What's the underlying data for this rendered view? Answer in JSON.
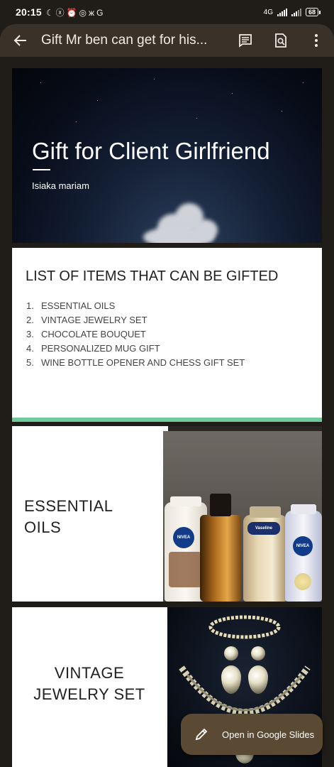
{
  "status_bar": {
    "time": "20:15",
    "notification_icons": [
      "moon-icon",
      "mute-icon",
      "alarm-icon",
      "instagram-icon",
      "butterfly-icon",
      "google-icon"
    ],
    "network": "4G",
    "battery": "68"
  },
  "app_bar": {
    "title": "Gift Mr ben can get for his...",
    "back_icon": "arrow-left-icon",
    "actions": [
      "comment-icon",
      "find-in-page-icon",
      "more-vert-icon"
    ]
  },
  "slides": {
    "title_slide": {
      "title": "Gift for Client Girlfriend",
      "author": "Isiaka mariam"
    },
    "list_slide": {
      "heading": "LIST OF ITEMS THAT CAN BE GIFTED",
      "items": [
        {
          "num": "1.",
          "text": "ESSENTIAL OILS"
        },
        {
          "num": "2.",
          "text": "VINTAGE JEWELRY SET"
        },
        {
          "num": "3.",
          "text": "CHOCOLATE BOUQUET"
        },
        {
          "num": "4.",
          "text": "PERSONALIZED MUG GIFT"
        },
        {
          "num": "5.",
          "text": "WINE BOTTLE OPENER AND CHESS GIFT SET"
        }
      ]
    },
    "oils_slide": {
      "line1": "ESSENTIAL",
      "line2": "OILS",
      "brands": [
        "NIVEA",
        "Vaseline",
        "NIVEA"
      ]
    },
    "jewelry_slide": {
      "line1": "VINTAGE",
      "line2": "JEWELRY SET"
    }
  },
  "fab": {
    "label": "Open in Google Slides",
    "icon": "pencil-icon"
  },
  "colors": {
    "app_bar_bg": "#3a3228",
    "background": "#201c17",
    "accent_strip": "#6fc99b",
    "fab_bg": "#5a4a33"
  }
}
